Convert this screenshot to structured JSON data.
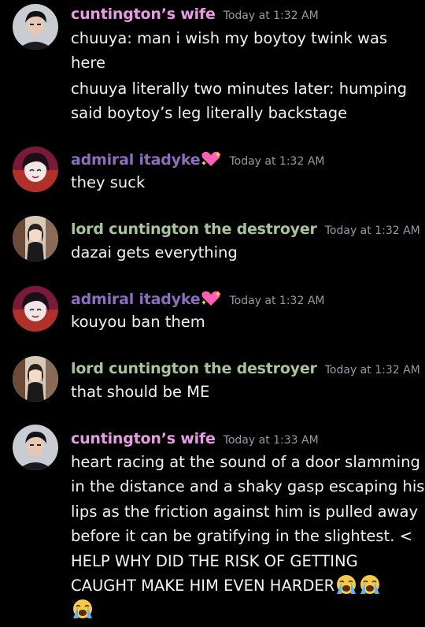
{
  "colors": {
    "background": "#000000",
    "wife": "#e89be3",
    "admiral": "#8e6cc0",
    "lord": "#a7c59a",
    "timestamp": "#949ba4",
    "text": "#f2f3f5"
  },
  "messages": [
    {
      "author": "cuntington’s wife",
      "timestamp": "Today at 1:32 AM",
      "lines": [
        "chuuya: man i wish my boytoy twink was",
        "here",
        "chuuya literally two minutes later: humping",
        "said boytoy’s leg literally backstage"
      ]
    },
    {
      "author": "admiral itadyke",
      "timestamp": "Today at 1:32 AM",
      "lines": [
        "they suck"
      ]
    },
    {
      "author": "lord cuntington the destroyer",
      "timestamp": "Today at 1:32 AM",
      "lines": [
        "dazai gets everything"
      ]
    },
    {
      "author": "admiral itadyke",
      "timestamp": "Today at 1:32 AM",
      "lines": [
        "kouyou ban them"
      ]
    },
    {
      "author": "lord cuntington the destroyer",
      "timestamp": "Today at 1:32 AM",
      "lines": [
        "that should be ME"
      ]
    },
    {
      "author": "cuntington’s wife",
      "timestamp": "Today at 1:33 AM",
      "lines": [
        "heart racing at the sound of a door slamming",
        "in the distance and a shaky gasp escaping his",
        "lips as the friction against him is pulled away",
        "before it can be gratifying in the slightest. <",
        "HELP WHY DID THE RISK OF GETTING",
        "CAUGHT MAKE HIM EVEN HARDER"
      ],
      "emoji": "loudly-crying-face"
    }
  ]
}
